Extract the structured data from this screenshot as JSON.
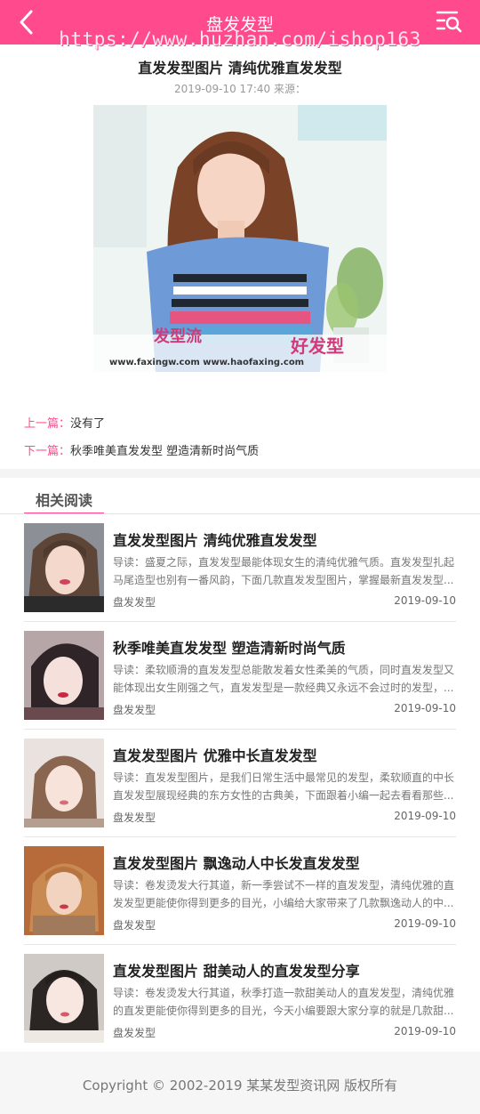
{
  "header": {
    "title": "盘发发型",
    "watermark": "https://www.huzhan.com/ishop163"
  },
  "article": {
    "title": "直发发型图片 清纯优雅直发发型",
    "date": "2019-09-10 17:40",
    "source_label": "来源：",
    "image_caption_1": "发型流",
    "image_caption_2": "好发型",
    "image_url_text": "www.faxingw.com www.haofaxing.com"
  },
  "pager": {
    "prev_label": "上一篇：",
    "prev_text": "没有了",
    "next_label": "下一篇：",
    "next_text": "秋季唯美直发发型 塑造清新时尚气质"
  },
  "related": {
    "heading": "相关阅读",
    "items": [
      {
        "title": "直发发型图片 清纯优雅直发发型",
        "desc": "导读：盛夏之际，直发发型最能体现女生的清纯优雅气质。直发发型扎起马尾造型也别有一番风韵，下面几款直发发型图片，掌握最新直发发型...",
        "category": "盘发发型",
        "date": "2019-09-10"
      },
      {
        "title": "秋季唯美直发发型 塑造清新时尚气质",
        "desc": "导读：柔软顺滑的直发发型总能散发着女性柔美的气质，同时直发发型又能体现出女生刚强之气，直发发型是一款经典又永远不会过时的发型，...",
        "category": "盘发发型",
        "date": "2019-09-10"
      },
      {
        "title": "直发发型图片 优雅中长直发发型",
        "desc": "导读：直发发型图片，是我们日常生活中最常见的发型，柔软顺直的中长直发发型展现经典的东方女性的古典美，下面跟着小编一起去看看那些...",
        "category": "盘发发型",
        "date": "2019-09-10"
      },
      {
        "title": "直发发型图片 飘逸动人中长发直发发型",
        "desc": "导读：卷发烫发大行其道，新一季尝试不一样的直发发型，清纯优雅的直发发型更能使你得到更多的目光，小编给大家带来了几款飘逸动人的中...",
        "category": "盘发发型",
        "date": "2019-09-10"
      },
      {
        "title": "直发发型图片 甜美动人的直发发型分享",
        "desc": "导读：卷发烫发大行其道，秋季打造一款甜美动人的直发发型，清纯优雅的直发更能使你得到更多的目光，今天小编要跟大家分享的就是几款甜...",
        "category": "盘发发型",
        "date": "2019-09-10"
      }
    ]
  },
  "footer": {
    "copyright": "Copyright © 2002-2019 某某发型资讯网 版权所有"
  },
  "colors": {
    "accent": "#ff4a8d",
    "footer_bg": "#f6f6f6"
  },
  "icons": {
    "back": "chevron-left-icon",
    "menu": "search-list-icon"
  }
}
